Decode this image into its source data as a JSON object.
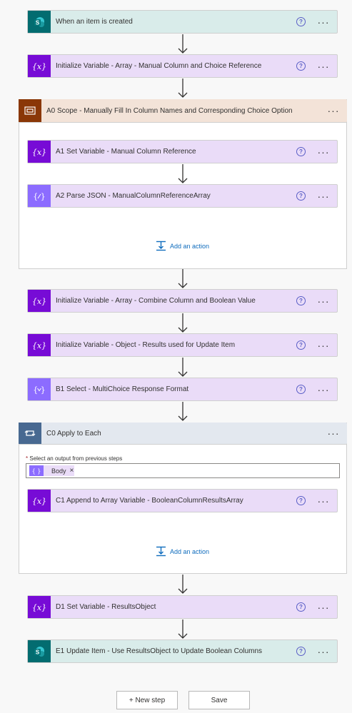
{
  "steps": {
    "trigger": {
      "title": "When an item is created",
      "icon": "sharepoint-icon",
      "color": "#036c70"
    },
    "init_array": {
      "title": "Initialize Variable - Array - Manual Column and Choice Reference",
      "icon": "variable-icon"
    },
    "scope_a0": {
      "title": "A0 Scope - Manually Fill In Column Names and Corresponding Choice Option",
      "icon": "scope-icon",
      "color": "#8a3707",
      "a1": {
        "title": "A1 Set Variable - Manual Column Reference"
      },
      "a2": {
        "title": "A2 Parse JSON - ManualColumnReferenceArray"
      },
      "add_action": "Add an action"
    },
    "init_combine": {
      "title": "Initialize Variable - Array - Combine Column and Boolean Value"
    },
    "init_object": {
      "title": "Initialize Variable - Object - Results used for Update Item"
    },
    "select_b1": {
      "title": "B1 Select - MultiChoice Response Format"
    },
    "apply_c0": {
      "title": "C0 Apply to Each",
      "output_label_required": "*",
      "output_label": "Select an output from previous steps",
      "token": "Body",
      "token_remove": "×",
      "c1": {
        "title": "C1 Append to Array Variable - BooleanColumnResultsArray"
      },
      "add_action": "Add an action"
    },
    "set_d1": {
      "title": "D1 Set Variable - ResultsObject"
    },
    "update_e1": {
      "title": "E1 Update Item - Use ResultsObject to Update Boolean Columns"
    }
  },
  "help_glyph": "?",
  "more_glyph": "···",
  "footer": {
    "new_step": "+ New step",
    "save": "Save"
  },
  "colors": {
    "variable_purple": "#770bd6",
    "variable_light": "#eadcf8",
    "sharepoint_teal": "#036c70",
    "sharepoint_light": "#d9ecea",
    "scope_brown": "#8a3707",
    "scope_light": "#f3e3d8",
    "apply_blue": "#486991",
    "apply_light": "#e3e8ef",
    "select_purple": "#8c6cff"
  }
}
